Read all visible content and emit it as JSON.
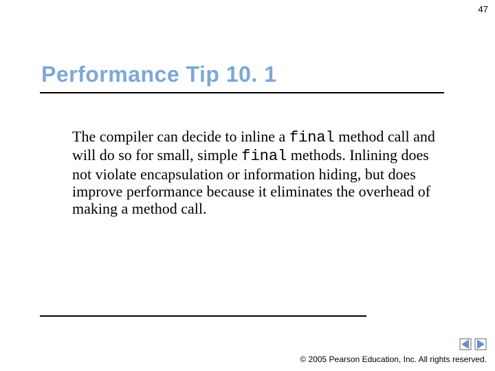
{
  "page_number": "47",
  "title": "Performance Tip 10. 1",
  "body": {
    "seg1": "The compiler can decide to inline a ",
    "code1": "final",
    "seg2": " method call and will do so for small, simple ",
    "code2": "final",
    "seg3": " methods. Inlining does not violate encapsulation or information hiding, but does improve performance because it eliminates the overhead of making a method call."
  },
  "copyright": "© 2005 Pearson Education, Inc. All rights reserved.",
  "colors": {
    "title": "#7da7d9",
    "arrow": "#6b8fc4"
  },
  "nav": {
    "prev": "previous-slide",
    "next": "next-slide"
  }
}
